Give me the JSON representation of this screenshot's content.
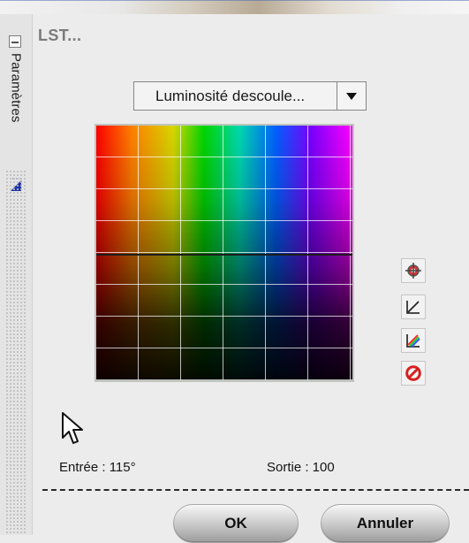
{
  "left_panel": {
    "tab_label": "Paramètres"
  },
  "panel": {
    "title": "LST...",
    "dropdown": {
      "selected": "Luminosité descoule...",
      "arrow_icon": "triangle-down-icon"
    },
    "graph": {
      "colors": {
        "grid": "#ffffff",
        "curve": "#1d1d1d"
      }
    },
    "tools": [
      {
        "name": "crosshair-icon"
      },
      {
        "name": "curve-icon"
      },
      {
        "name": "color-curve-icon"
      },
      {
        "name": "reset-icon"
      }
    ],
    "readouts": {
      "entree": "Entrée : 115°",
      "sortie": "Sortie : 100"
    },
    "buttons": {
      "ok": "OK",
      "cancel": "Annuler"
    }
  }
}
